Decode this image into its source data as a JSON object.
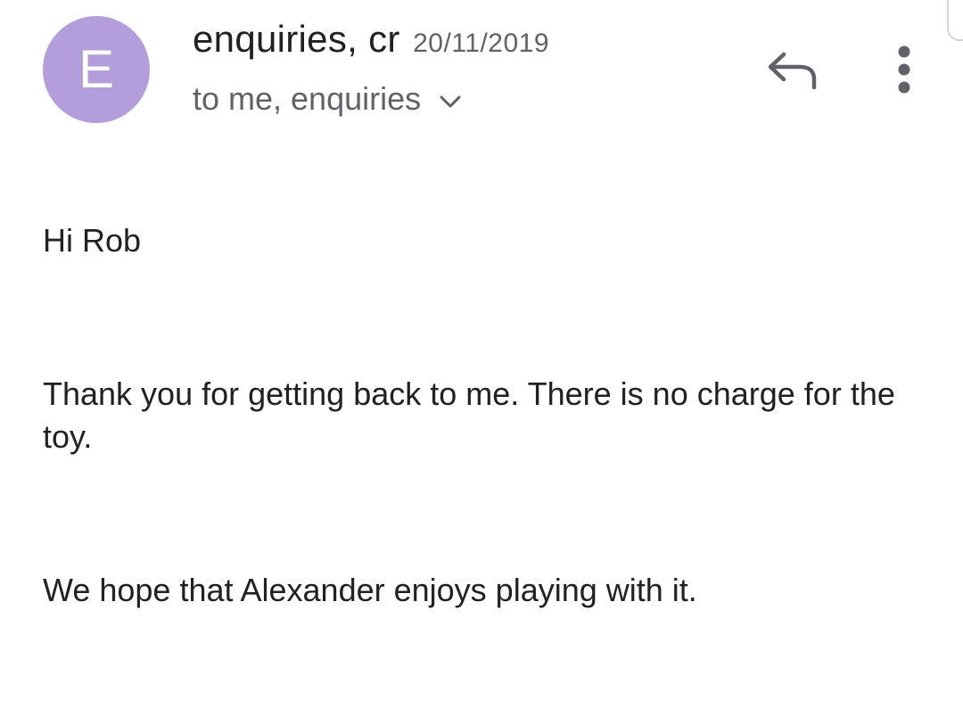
{
  "colors": {
    "avatar_bg": "#b39ddb",
    "icon_color": "#5f6368"
  },
  "sender": {
    "avatar_letter": "E",
    "name": "enquiries, cr",
    "date": "20/11/2019",
    "recipients": "to me, enquiries"
  },
  "icons": {
    "expand": "chevron-down-icon",
    "reply": "reply-arrow-icon",
    "more": "more-vertical-icon"
  },
  "message": {
    "greeting": "Hi Rob",
    "paragraph_1": "Thank you for getting back to me. There is no charge for the toy.",
    "paragraph_2": "We hope that Alexander enjoys playing with it."
  }
}
